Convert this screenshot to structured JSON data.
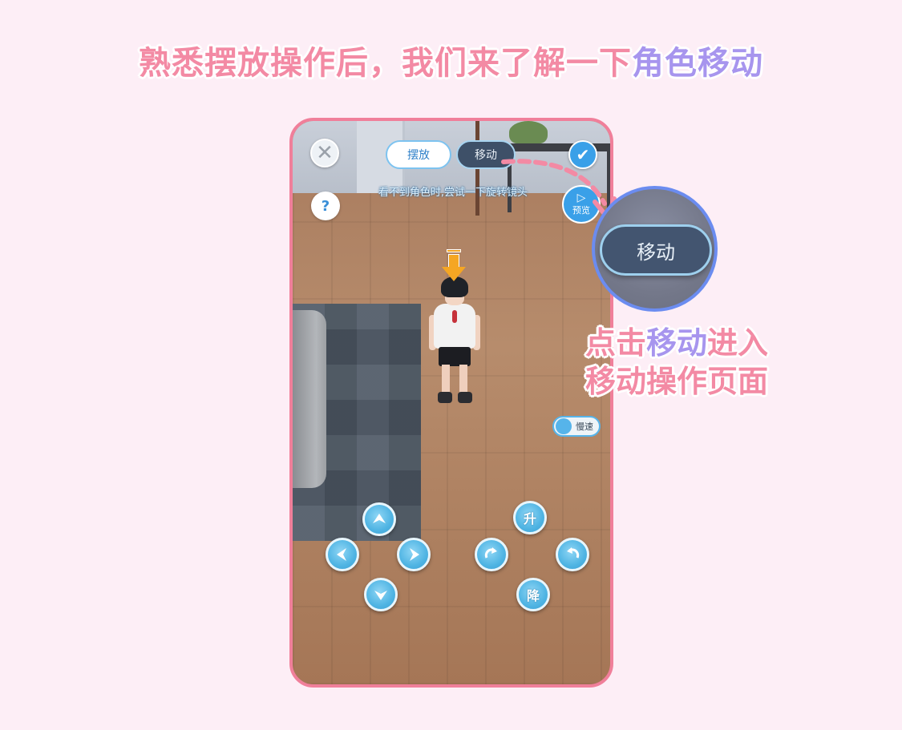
{
  "headline": {
    "part1": "熟悉摆放操作后，我们来了解一下",
    "part2": "角色移动"
  },
  "toolbar": {
    "close_icon": "close-icon",
    "tab_place_label": "摆放",
    "tab_move_label": "移动",
    "confirm_icon": "check-icon",
    "help_label": "?",
    "hint_text": "看不到角色时,尝试一下旋转镜头",
    "preview_label": "预览"
  },
  "speed_toggle": {
    "label": "慢速"
  },
  "controls": {
    "up_icon": "arrow-up-icon",
    "down_icon": "arrow-down-icon",
    "left_icon": "arrow-left-icon",
    "right_icon": "arrow-right-icon",
    "rotate_left_icon": "rotate-ccw-icon",
    "rotate_right_icon": "rotate-cw-icon",
    "raise_label": "升",
    "lower_label": "降"
  },
  "callout": {
    "zoom_button_label": "移动",
    "line1_a": "点击",
    "line1_b": "移动",
    "line1_c": "进入",
    "line2": "移动操作页面"
  },
  "colors": {
    "background": "#fdeef6",
    "accent_pink": "#f38aa4",
    "accent_purple": "#a795ee",
    "button_blue": "#4fb4e3",
    "frame_pink": "#f07f9a"
  }
}
